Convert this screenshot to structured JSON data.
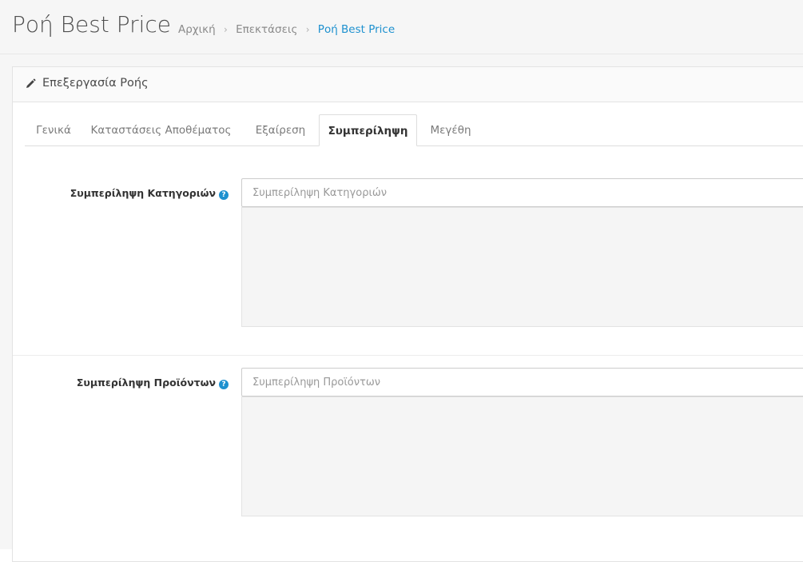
{
  "header": {
    "title": "Ροή Best Price",
    "breadcrumb": [
      {
        "label": "Αρχική"
      },
      {
        "label": "Επεκτάσεις"
      },
      {
        "label": "Ροή Best Price"
      }
    ],
    "breadcrumb_separator": "›"
  },
  "panel": {
    "title": "Επεξεργασία Ροής",
    "icon": "pencil-icon"
  },
  "tabs": [
    {
      "label": "Γενικά",
      "active": false
    },
    {
      "label": "Καταστάσεις Αποθέματος",
      "active": false
    },
    {
      "label": "Εξαίρεση",
      "active": false
    },
    {
      "label": "Συμπερίληψη",
      "active": true
    },
    {
      "label": "Μεγέθη",
      "active": false
    }
  ],
  "form": {
    "categories": {
      "label": "Συμπερίληψη Κατηγοριών",
      "placeholder": "Συμπερίληψη Κατηγοριών",
      "value": ""
    },
    "products": {
      "label": "Συμπερίληψη Προϊόντων",
      "placeholder": "Συμπερίληψη Προϊόντων",
      "value": ""
    },
    "help_icon": "question-circle-icon",
    "help_glyph": "?"
  },
  "colors": {
    "accent": "#1e91cf",
    "background": "#f6f6f6"
  }
}
